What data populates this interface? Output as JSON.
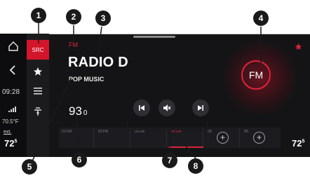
{
  "callouts": [
    "1",
    "2",
    "3",
    "4",
    "5",
    "6",
    "7",
    "8"
  ],
  "rail": {
    "clock": "09:28",
    "temperature": "70.5°F",
    "ext_label": "ext.",
    "left_setpoint": "72",
    "left_setpoint_frac": "5"
  },
  "source": {
    "button_label": "SRC"
  },
  "radio": {
    "band": "FM",
    "station_name": "RADIO D",
    "genre": "POP MUSIC",
    "frequency_main": "93",
    "frequency_decimal": "0",
    "band_badge": "FM"
  },
  "presets": [
    {
      "label": "01.FM",
      "active": false
    },
    {
      "label": "02.FM",
      "active": false
    },
    {
      "label": "03.FM",
      "active": false
    },
    {
      "label": "04.FM",
      "active": true
    },
    {
      "label": "05.",
      "empty": true
    },
    {
      "label": "06.",
      "empty": true
    }
  ],
  "add_symbol": "+",
  "right_setpoint": "72",
  "right_setpoint_frac": "5",
  "colors": {
    "accent": "#e0233a",
    "screen_bg": "#141416",
    "callout_bg": "#1a1a1a"
  }
}
